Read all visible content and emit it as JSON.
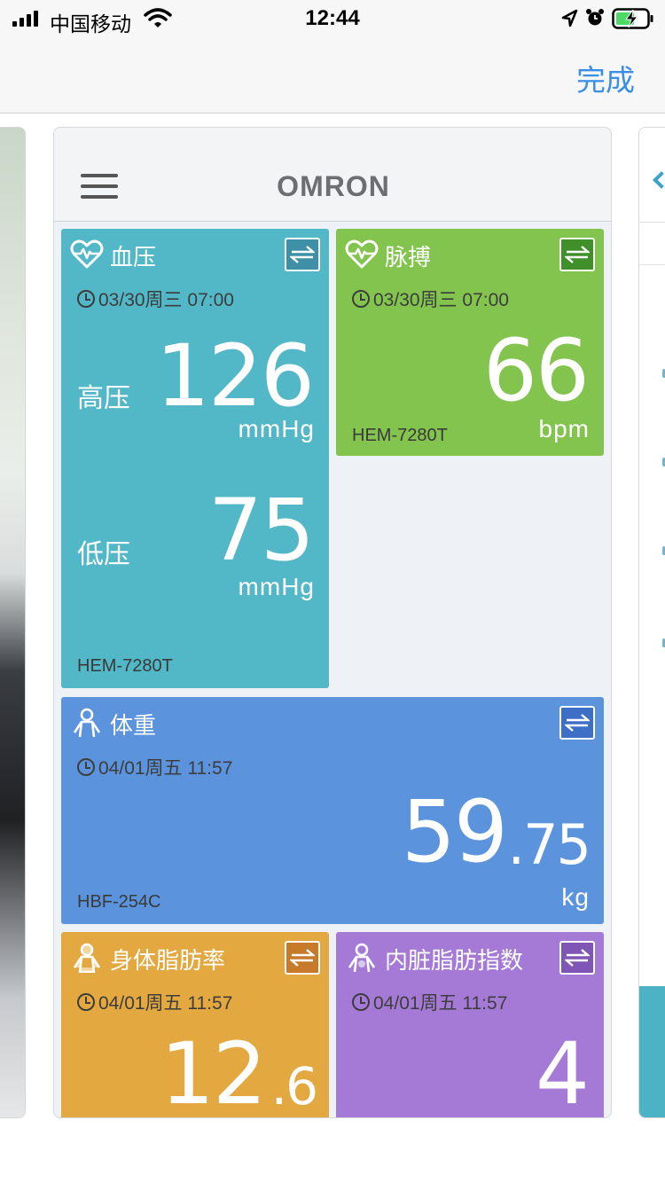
{
  "status_bar": {
    "carrier": "中国移动",
    "time": "12:44"
  },
  "nav": {
    "done_label": "完成"
  },
  "app": {
    "logo": "OMRON"
  },
  "tiles": {
    "blood_pressure": {
      "title": "血压",
      "time": "03/30周三 07:00",
      "systolic_label": "高压",
      "systolic_value": "126",
      "systolic_unit": "mmHg",
      "diastolic_label": "低压",
      "diastolic_value": "75",
      "diastolic_unit": "mmHg",
      "model": "HEM-7280T",
      "color": "#52b7c7"
    },
    "pulse": {
      "title": "脉搏",
      "time": "03/30周三 07:00",
      "value": "66",
      "unit": "bpm",
      "model": "HEM-7280T",
      "color": "#83c44f"
    },
    "weight": {
      "title": "体重",
      "time": "04/01周五 11:57",
      "value_int": "59",
      "value_dec": ".75",
      "unit": "kg",
      "model": "HBF-254C",
      "color": "#5b94dc"
    },
    "body_fat": {
      "title": "身体脂肪率",
      "time": "04/01周五 11:57",
      "value_int": "12",
      "value_dec": ".6",
      "color": "#e3a83f"
    },
    "visceral_fat": {
      "title": "内脏脂肪指数",
      "time": "04/01周五 11:57",
      "value": "4",
      "color": "#a57ad6"
    }
  }
}
